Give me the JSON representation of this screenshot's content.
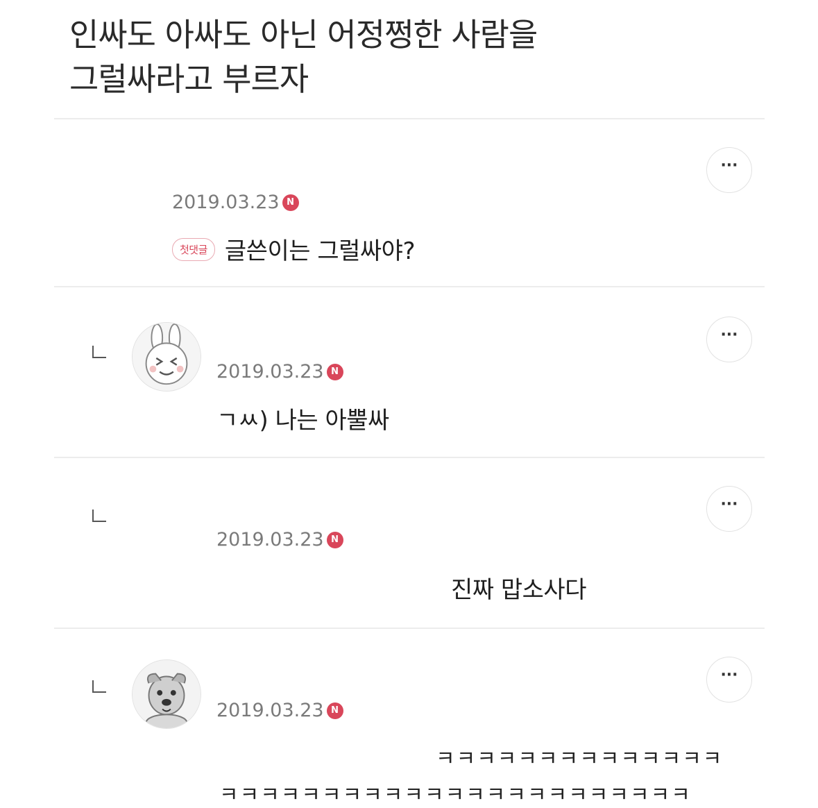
{
  "post": {
    "title_line1": "인싸도 아싸도 아닌 어정쩡한 사람을",
    "title_line2": "그럴싸라고 부르자"
  },
  "comments": [
    {
      "date": "2019.03.23",
      "new_badge": "N",
      "first_comment_badge": "첫댓글",
      "text": "글쓴이는 그럴싸야?",
      "more_label": "···",
      "is_reply": false,
      "avatar": "none"
    },
    {
      "date": "2019.03.23",
      "new_badge": "N",
      "text": "ㄱㅆ) 나는 아뿔싸",
      "more_label": "···",
      "is_reply": true,
      "avatar": "rabbit-avatar-icon"
    },
    {
      "date": "2019.03.23",
      "new_badge": "N",
      "text": "진짜 맙소사다",
      "more_label": "···",
      "is_reply": true,
      "avatar": "none"
    },
    {
      "date": "2019.03.23",
      "new_badge": "N",
      "text_line1": "ㅋㅋㅋㅋㅋㅋㅋㅋㅋㅋㅋㅋㅋㅋ",
      "text_line2": "ㅋㅋㅋㅋㅋㅋㅋㅋㅋㅋㅋㅋㅋㅋㅋㅋㅋㅋㅋㅋㅋㅋㅋ",
      "more_label": "···",
      "is_reply": true,
      "avatar": "dog-avatar-icon"
    }
  ],
  "colors": {
    "new_badge": "#d9465a",
    "date_text": "#7a7a7a",
    "divider": "#ececec"
  }
}
